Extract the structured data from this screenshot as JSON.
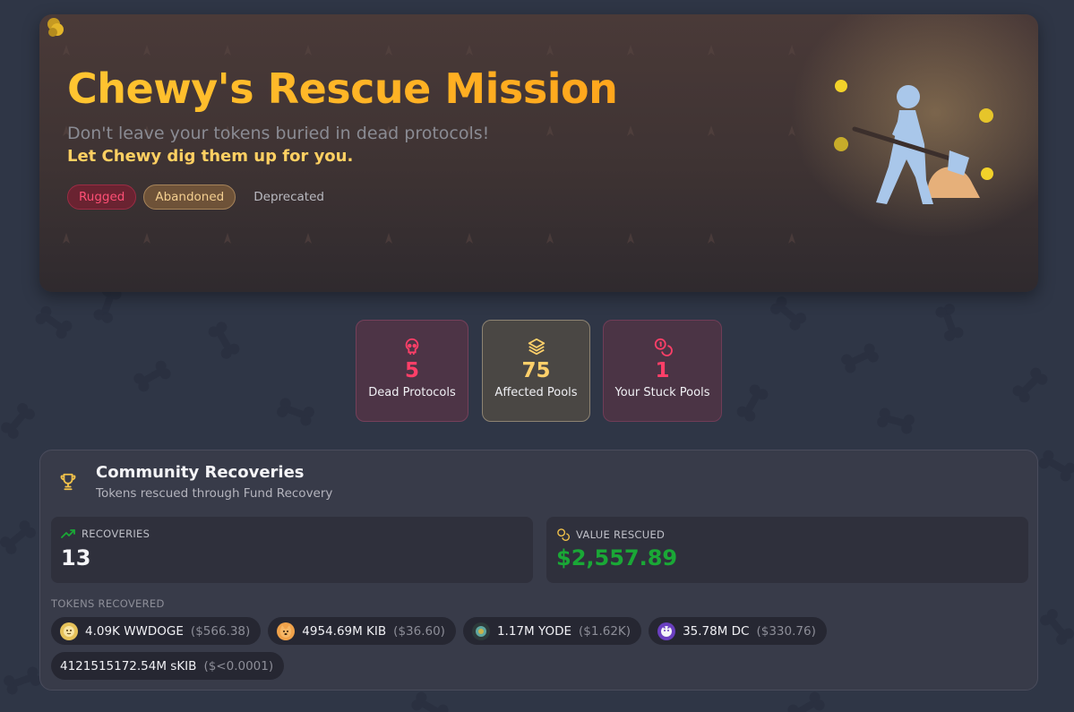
{
  "hero": {
    "title": "Chewy's Rescue Mission",
    "subtitle": "Don't leave your tokens buried in dead protocols!",
    "tagline": "Let Chewy dig them up for you.",
    "tags": [
      "Rugged",
      "Abandoned",
      "Deprecated"
    ],
    "logo_icon": "coins-logo-icon",
    "illustration_icon": "digging-person-icon"
  },
  "stats": [
    {
      "icon": "skull-icon",
      "value": "5",
      "label": "Dead Protocols"
    },
    {
      "icon": "layers-icon",
      "value": "75",
      "label": "Affected Pools"
    },
    {
      "icon": "coins-icon",
      "value": "1",
      "label": "Your Stuck Pools"
    }
  ],
  "community": {
    "icon": "trophy-icon",
    "title": "Community Recoveries",
    "subtitle": "Tokens rescued through Fund Recovery",
    "recoveries_label": "RECOVERIES",
    "recoveries_value": "13",
    "value_label": "VALUE RESCUED",
    "value_value": "$2,557.89",
    "tokens_label": "TOKENS RECOVERED",
    "tokens": [
      {
        "amount": "4.09K WWDOGE",
        "usd": "($566.38)",
        "icon": "doge-token-icon"
      },
      {
        "amount": "4954.69M KIB",
        "usd": "($36.60)",
        "icon": "kib-token-icon"
      },
      {
        "amount": "1.17M YODE",
        "usd": "($1.62K)",
        "icon": "yode-token-icon"
      },
      {
        "amount": "35.78M DC",
        "usd": "($330.76)",
        "icon": "dc-token-icon"
      },
      {
        "amount": "4121515172.54M sKIB",
        "usd": "($<0.0001)",
        "icon": ""
      }
    ]
  },
  "colors": {
    "background": "#2f3646",
    "accent_gold": "#ffc531",
    "accent_red": "#ff3f68",
    "success_green": "#1aa836"
  }
}
